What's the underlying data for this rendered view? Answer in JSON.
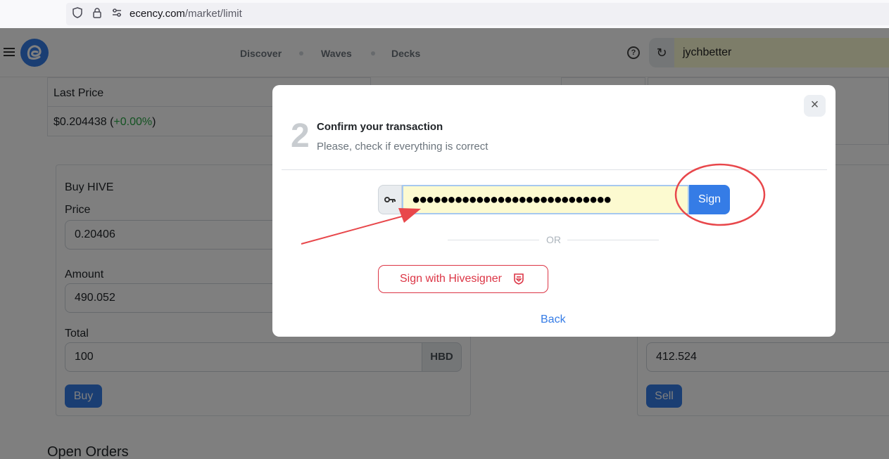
{
  "browser": {
    "url_domain": "ecency.com",
    "url_path": "/market/limit"
  },
  "header": {
    "nav": [
      "Discover",
      "Waves",
      "Decks"
    ],
    "help_symbol": "?",
    "username": "jychbetter"
  },
  "market": {
    "last_price_label": "Last Price",
    "last_price_value": "$0.204438",
    "last_price_open": " (",
    "last_price_change": "+0.00%",
    "last_price_close": ")",
    "change_color": "#28a745"
  },
  "buy_form": {
    "title": "Buy HIVE",
    "price_label": "Price",
    "price_value": "0.20406",
    "amount_label": "Amount",
    "amount_value": "490.052",
    "total_label": "Total",
    "total_value": "100",
    "total_currency": "HBD",
    "buy_button": "Buy"
  },
  "sell_form": {
    "amount_value": "412.524",
    "sell_button": "Sell"
  },
  "open_orders_heading": "Open Orders",
  "modal": {
    "step_number": "2",
    "title": "Confirm your transaction",
    "subtitle": "Please, check if everything is correct",
    "key_icon": "key-icon",
    "key_mask": "●●●●●●●●●●●●●●●●●●●●●●●●●●●●",
    "sign_label": "Sign",
    "or_label": "OR",
    "hivesigner_label": "Sign with Hivesigner",
    "back_label": "Back",
    "close_symbol": "×"
  },
  "annotation_color": "#e8474b",
  "brand_color": "#357ce6"
}
